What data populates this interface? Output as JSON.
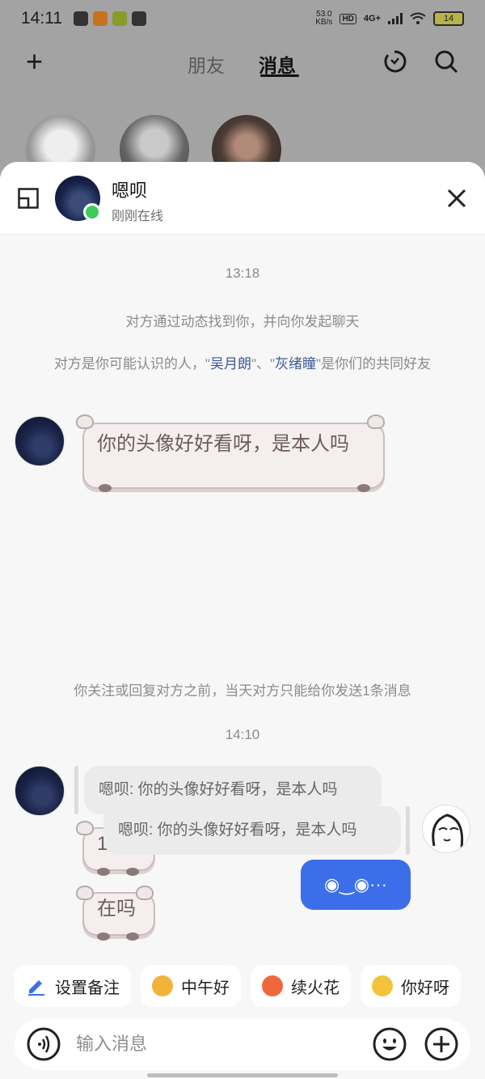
{
  "status_bar": {
    "time": "14:11",
    "net_speed_value": "53.0",
    "net_speed_unit": "KB/s",
    "hd": "HD",
    "network": "4G+",
    "battery": "14"
  },
  "top_nav": {
    "tabs": [
      {
        "label": "朋友"
      },
      {
        "label": "消息"
      }
    ],
    "active_tab": "消息"
  },
  "header": {
    "contact_name": "嗯呗",
    "contact_status": "刚刚在线"
  },
  "chat": {
    "time_1": "13:18",
    "sys_1": "对方通过动态找到你，并向你发起聊天",
    "sys_2_prefix": "对方是你可能认识的人，\"",
    "mutual_1": "吴月朗",
    "sys_2_mid": "\"、\"",
    "mutual_2": "灰绪瞳",
    "sys_2_suffix": "\"是你们的共同好友",
    "msg_1": "你的头像好好看呀，是本人吗",
    "sys_3": "你关注或回复对方之前，当天对方只能给你发送1条消息",
    "time_2": "14:10",
    "quote_1": "嗯呗: 你的头像好好看呀，是本人吗",
    "msg_2": "111",
    "msg_3": "在吗",
    "quote_2": "嗯呗: 你的头像好好看呀，是本人吗",
    "my_msg": "◉‿◉···"
  },
  "quick_replies": [
    {
      "label": "设置备注",
      "icon": "pencil-icon",
      "color": "#3b6ee8"
    },
    {
      "label": "中午好",
      "icon": "sunglasses-emoji-icon",
      "color": "#f3b33b"
    },
    {
      "label": "续火花",
      "icon": "fire-emoji-icon",
      "color": "#f0683a"
    },
    {
      "label": "你好呀",
      "icon": "laugh-emoji-icon",
      "color": "#f3c33b"
    }
  ],
  "input": {
    "placeholder": "输入消息"
  }
}
